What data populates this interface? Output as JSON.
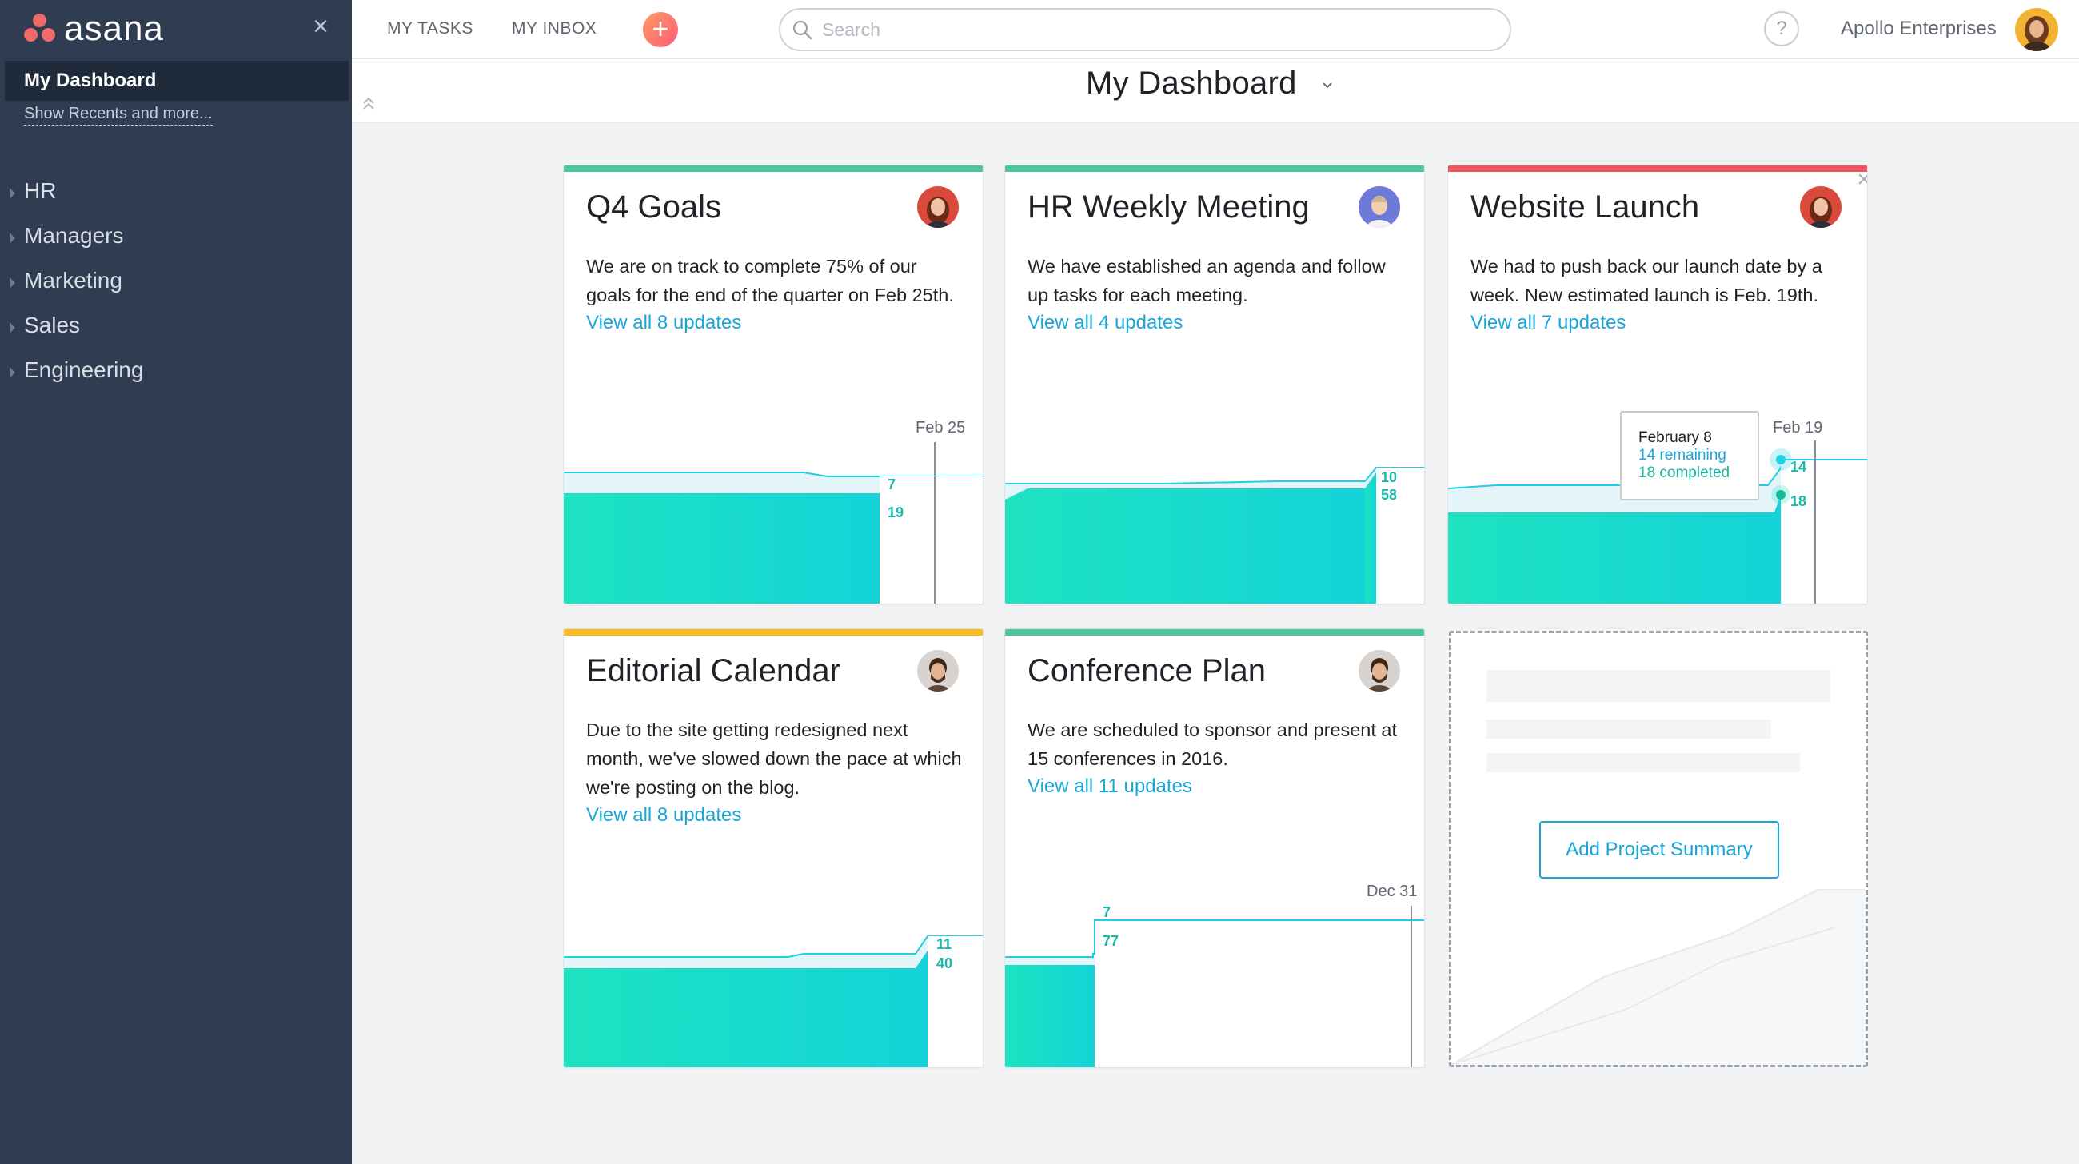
{
  "sidebar": {
    "logo_text": "asana",
    "dashboard_label": "My Dashboard",
    "recents_link": "Show Recents and more...",
    "teams": [
      "HR",
      "Managers",
      "Marketing",
      "Sales",
      "Engineering"
    ]
  },
  "topbar": {
    "my_tasks": "MY TASKS",
    "my_inbox": "MY INBOX",
    "search_placeholder": "Search",
    "help": "?",
    "workspace": "Apollo Enterprises"
  },
  "page": {
    "title": "My Dashboard"
  },
  "colors": {
    "green": "#4cc79a",
    "red": "#f0545c",
    "yellow": "#fcbd1c",
    "link": "#1aa5d8",
    "teal": "#1ad1c3"
  },
  "cards": [
    {
      "title": "Q4 Goals",
      "description": "We are on track to complete 75% of our goals for the end of the quarter on Feb 25th.",
      "link": "View all 8 updates",
      "chart": {
        "date_label": "Feb 25",
        "remaining": "7",
        "completed": "19"
      }
    },
    {
      "title": "HR Weekly Meeting",
      "description": "We have established an agenda and follow up tasks for each meeting.",
      "link": "View all 4 updates",
      "chart": {
        "remaining": "10",
        "completed": "58"
      }
    },
    {
      "title": "Website Launch",
      "description": "We had to push back our launch date by a week. New estimated launch is Feb. 19th.",
      "link": "View all 7 updates",
      "chart": {
        "date_label": "Feb 19",
        "remaining": "14",
        "completed": "18",
        "tooltip": {
          "date": "February 8",
          "remaining": "14 remaining",
          "completed": "18 completed"
        }
      }
    },
    {
      "title": "Editorial Calendar",
      "description": "Due to the site getting redesigned next month, we've slowed down the pace at which we're posting on the blog.",
      "link": "View all 8 updates",
      "chart": {
        "remaining": "11",
        "completed": "40"
      }
    },
    {
      "title": "Conference Plan",
      "description": "We are scheduled to sponsor and present at 15 conferences in 2016.",
      "link": "View all 11 updates",
      "chart": {
        "date_label": "Dec 31",
        "remaining": "7",
        "completed": "77"
      }
    }
  ],
  "add_card": {
    "button": "Add Project Summary"
  }
}
